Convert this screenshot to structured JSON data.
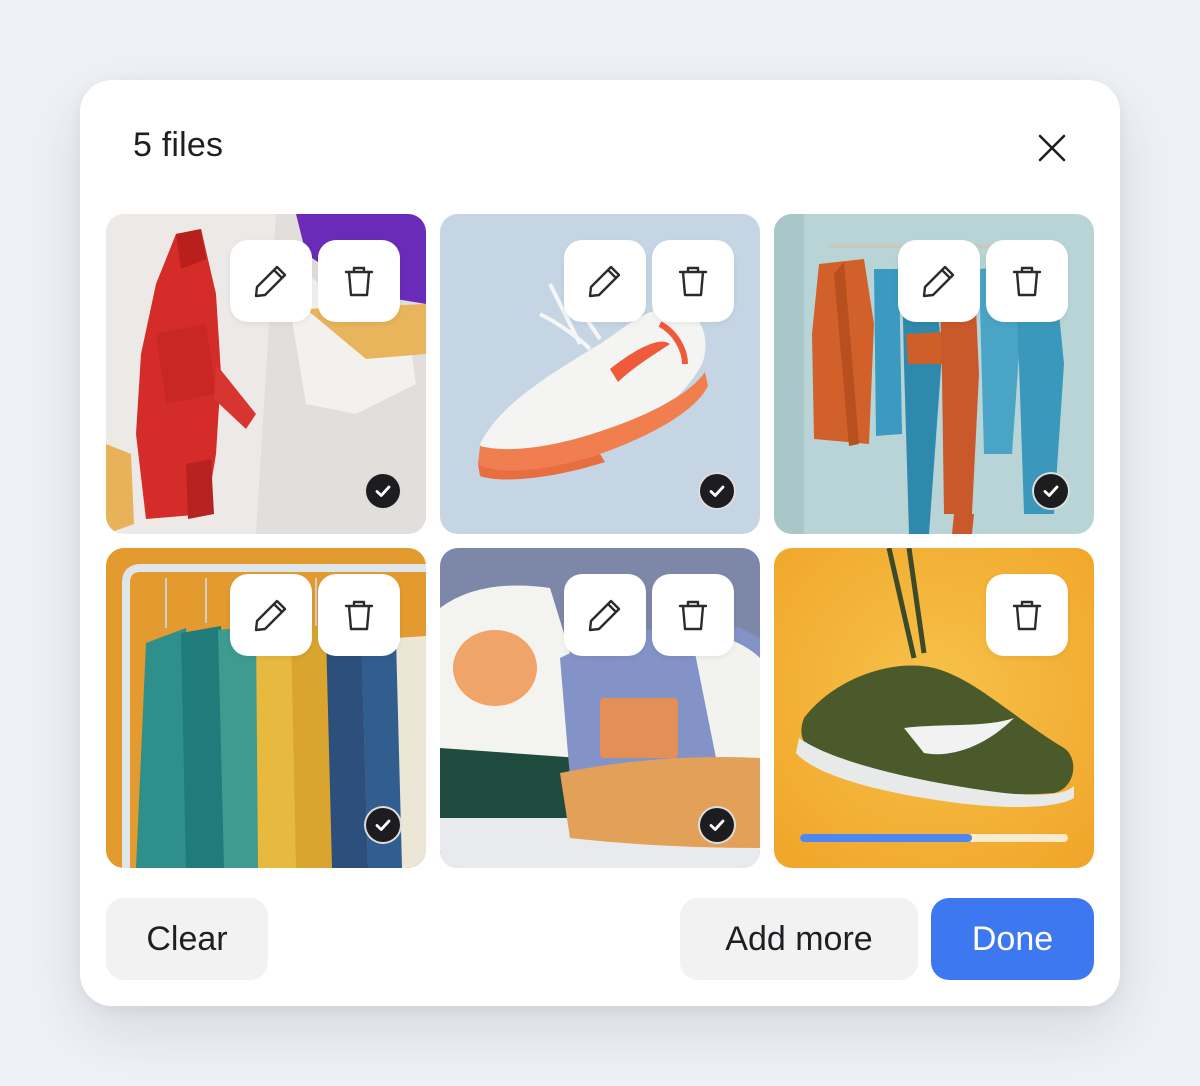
{
  "dialog": {
    "title": "5 files",
    "close_icon": "close-icon"
  },
  "tiles": [
    {
      "subject": "red hooded jacket on hanger",
      "status": "uploaded",
      "actions": [
        "edit",
        "delete"
      ]
    },
    {
      "subject": "white and orange sneaker",
      "status": "uploaded",
      "actions": [
        "edit",
        "delete"
      ]
    },
    {
      "subject": "orange and teal clothes on rail",
      "status": "uploaded",
      "actions": [
        "edit",
        "delete"
      ]
    },
    {
      "subject": "shirts on clothing rack",
      "status": "uploaded",
      "actions": [
        "edit",
        "delete"
      ]
    },
    {
      "subject": "baseball caps",
      "status": "uploaded",
      "actions": [
        "edit",
        "delete"
      ]
    },
    {
      "subject": "green sneaker hanging by laces",
      "status": "uploading",
      "actions": [
        "delete"
      ],
      "progress": 0.64
    }
  ],
  "footer": {
    "clear_label": "Clear",
    "add_more_label": "Add more",
    "done_label": "Done"
  },
  "colors": {
    "accent": "#3d78f0",
    "progress": "#4f87f0",
    "secondary_button": "#f2f2f3",
    "background": "#eef1f5"
  }
}
